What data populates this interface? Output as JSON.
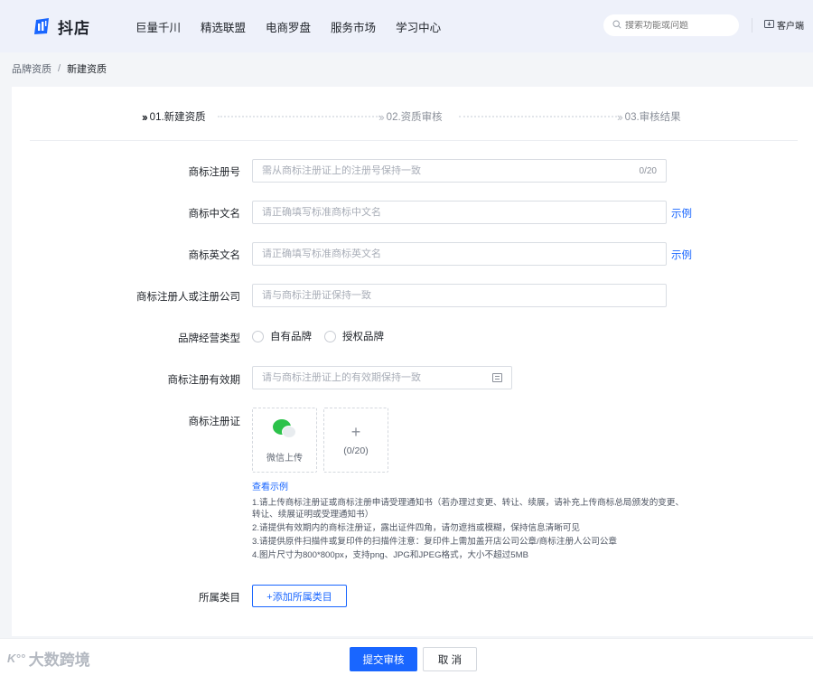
{
  "header": {
    "logo_text": "抖店",
    "nav": [
      "巨量千川",
      "精选联盟",
      "电商罗盘",
      "服务市场",
      "学习中心"
    ],
    "search_placeholder": "搜索功能或问题",
    "service_label": "客户端"
  },
  "breadcrumb": {
    "parent": "品牌资质",
    "separator": "/",
    "current": "新建资质"
  },
  "steps": [
    {
      "label": "01.新建资质",
      "active": true
    },
    {
      "label": "02.资质审核",
      "active": false
    },
    {
      "label": "03.审核结果",
      "active": false
    }
  ],
  "form": {
    "reg_no": {
      "label": "商标注册号",
      "placeholder": "需从商标注册证上的注册号保持一致",
      "counter": "0/20"
    },
    "cn_name": {
      "label": "商标中文名",
      "placeholder": "请正确填写标准商标中文名",
      "example": "示例"
    },
    "en_name": {
      "label": "商标英文名",
      "placeholder": "请正确填写标准商标英文名",
      "example": "示例"
    },
    "registrant": {
      "label": "商标注册人或注册公司",
      "placeholder": "请与商标注册证保持一致"
    },
    "brand_type": {
      "label": "品牌经营类型",
      "options": [
        "自有品牌",
        "授权品牌"
      ]
    },
    "validity": {
      "label": "商标注册有效期",
      "placeholder": "请与商标注册证上的有效期保持一致"
    },
    "certificate": {
      "label": "商标注册证",
      "wechat_upload": "微信上传",
      "upload_plus": "+",
      "upload_count": "(0/20)",
      "view_example": "查看示例",
      "notes": [
        "1.请上传商标注册证或商标注册申请受理通知书（若办理过变更、转让、续展，请补充上传商标总局颁发的变更、转让、续展证明或受理通知书）",
        "2.请提供有效期内的商标注册证，露出证件四角，请勿遮挡或模糊，保持信息清晰可见",
        "3.请提供原件扫描件或复印件的扫描件注意：复印件上需加盖开店公司公章/商标注册人公司公章",
        "4.图片尺寸为800*800px，支持png、JPG和JPEG格式，大小不超过5MB"
      ]
    },
    "category": {
      "label": "所属类目",
      "button": "+添加所属类目"
    }
  },
  "footer": {
    "submit": "提交审核",
    "cancel": "取 消",
    "watermark": "大数跨境",
    "watermark_logo": "K°°"
  },
  "colors": {
    "accent": "#1966ff",
    "wechat": "#2cc24a"
  }
}
